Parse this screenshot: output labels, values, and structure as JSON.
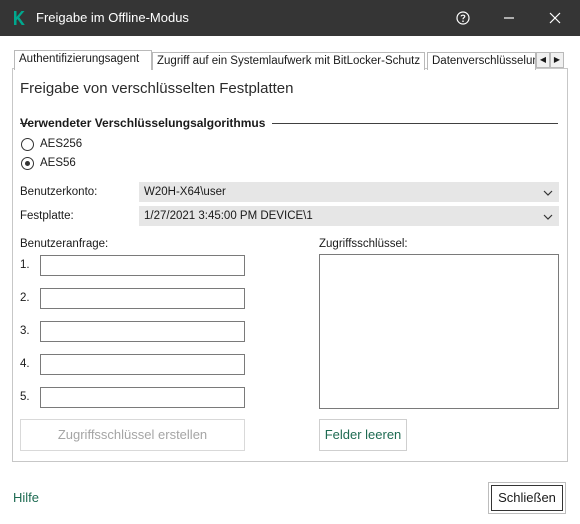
{
  "window": {
    "title": "Freigabe im Offline-Modus",
    "accent_color": "#1e6b52",
    "titlebar_color": "#353535"
  },
  "tabs": [
    {
      "label": "Authentifizierungsagent",
      "active": true
    },
    {
      "label": "Zugriff auf ein Systemlaufwerk mit BitLocker-Schutz",
      "active": false
    },
    {
      "label": "Datenverschlüsselun",
      "active": false
    }
  ],
  "section_title": "Freigabe von verschlüsselten Festplatten",
  "algorithm_group": {
    "title": "Verwendeter Verschlüsselungsalgorithmus",
    "options": [
      {
        "label": "AES256",
        "selected": false
      },
      {
        "label": "AES56",
        "selected": true
      }
    ]
  },
  "fields": {
    "account_label": "Benutzerkonto:",
    "account_value": "W20H-X64\\user",
    "disk_label": "Festplatte:",
    "disk_value": "1/27/2021 3:45:00 PM  DEVICE\\1"
  },
  "user_request": {
    "label": "Benutzeranfrage:",
    "rows": [
      {
        "num": "1.",
        "value": ""
      },
      {
        "num": "2.",
        "value": ""
      },
      {
        "num": "3.",
        "value": ""
      },
      {
        "num": "4.",
        "value": ""
      },
      {
        "num": "5.",
        "value": ""
      }
    ]
  },
  "access_key": {
    "label": "Zugriffsschlüssel:",
    "value": ""
  },
  "buttons": {
    "create_key": "Zugriffsschlüssel erstellen",
    "clear_fields": "Felder leeren",
    "close": "Schließen"
  },
  "footer": {
    "help": "Hilfe"
  }
}
